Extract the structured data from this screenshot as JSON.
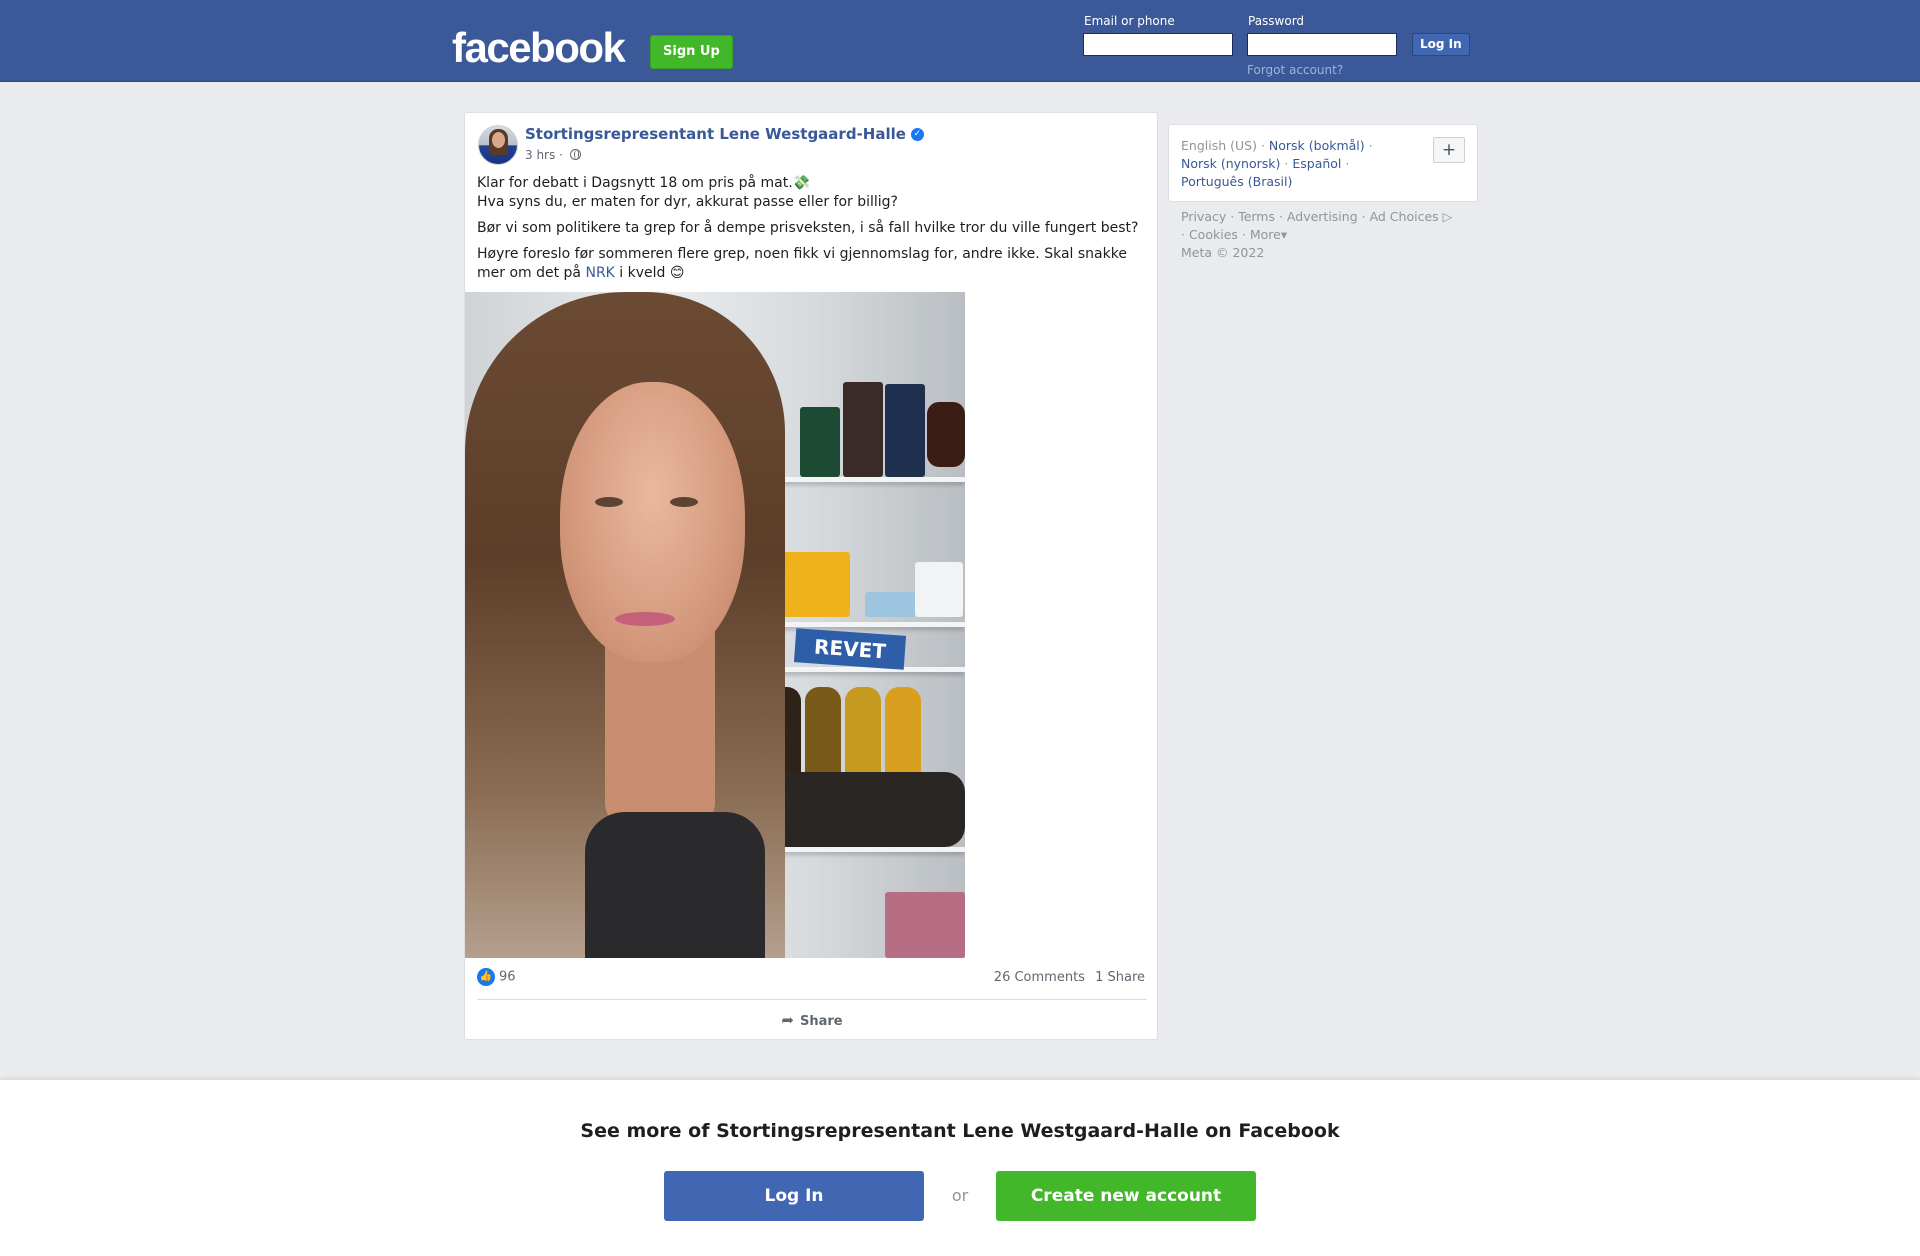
{
  "header": {
    "logo": "facebook",
    "signup_label": "Sign Up",
    "email_label": "Email or phone",
    "password_label": "Password",
    "login_label": "Log In",
    "forgot_label": "Forgot account?"
  },
  "post": {
    "author": "Stortingsrepresentant Lene Westgaard-Halle",
    "time": "3 hrs",
    "meta_sep": "·",
    "text": {
      "line1": "Klar for debatt i Dagsnytt 18 om pris på mat.💸",
      "line2": "Hva syns du, er maten for dyr, akkurat passe eller for billig?",
      "para2": "Bør vi som politikere ta grep for å dempe prisveksten, i så fall hvilke tror du ville fungert best?",
      "para3_before": "Høyre foreslo før sommeren flere grep, noen fikk vi gjennomslag for, andre ikke. Skal snakke mer om det på ",
      "para3_link": "NRK",
      "para3_after": " i kveld 😊"
    },
    "photo_text": "REVET",
    "likes": "96",
    "comments": "26 Comments",
    "shares": "1 Share",
    "share_label": "Share"
  },
  "languages": {
    "current": "English (US)",
    "others": [
      "Norsk (bokmål)",
      "Norsk (nynorsk)",
      "Español",
      "Português (Brasil)"
    ],
    "plus": "+"
  },
  "footer": {
    "links": [
      "Privacy",
      "Terms",
      "Advertising",
      "Ad Choices",
      "Cookies",
      "More"
    ],
    "copyright": "Meta © 2022"
  },
  "banner": {
    "title": "See more of Stortingsrepresentant Lene Westgaard-Halle on Facebook",
    "login_label": "Log In",
    "or_label": "or",
    "create_label": "Create new account"
  },
  "colors": {
    "brand": "#3b5998",
    "link": "#385898",
    "green": "#42b72a"
  }
}
